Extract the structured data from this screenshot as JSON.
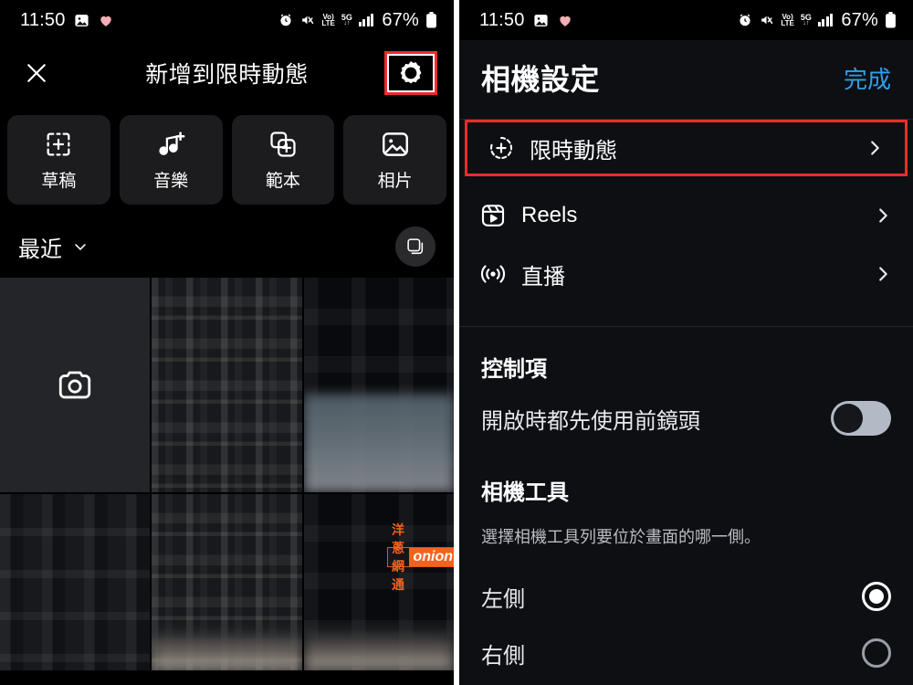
{
  "status_bar": {
    "time": "11:50",
    "battery_percent": "67%",
    "icons": [
      "photo-icon",
      "heart-icon",
      "alarm-icon",
      "mute-icon",
      "volte-icon",
      "5g-icon",
      "signal-icon",
      "battery-icon"
    ],
    "volte_top": "Vo)",
    "volte_bottom": "LTE",
    "net_top": "5G",
    "net_bottom": "↓↑"
  },
  "left_panel": {
    "close_label": "✕",
    "title": "新增到限時動態",
    "settings_icon": "gear-icon",
    "cards": [
      {
        "icon": "draft-plus-icon",
        "label": "草稿"
      },
      {
        "icon": "music-note-plus-icon",
        "label": "音樂"
      },
      {
        "icon": "template-plus-icon",
        "label": "範本"
      },
      {
        "icon": "photo-icon",
        "label": "相片"
      }
    ],
    "gallery": {
      "filter_label": "最近",
      "filter_chevron": "chevron-down-icon",
      "multiselect_icon": "layers-icon",
      "camera_tile_icon": "camera-icon"
    }
  },
  "right_panel": {
    "title": "相機設定",
    "done_label": "完成",
    "done_color": "#2f9fe8",
    "highlight_color": "#ef2b2b",
    "menu": [
      {
        "icon": "story-plus-icon",
        "label": "限時動態",
        "chevron": "chevron-right-icon",
        "highlighted": true
      },
      {
        "icon": "reels-icon",
        "label": "Reels",
        "chevron": "chevron-right-icon",
        "highlighted": false
      },
      {
        "icon": "live-icon",
        "label": "直播",
        "chevron": "chevron-right-icon",
        "highlighted": false
      }
    ],
    "controls": {
      "section_title": "控制項",
      "toggle_label": "開啟時都先使用前鏡頭",
      "toggle_state": "off"
    },
    "camera_tools": {
      "section_title": "相機工具",
      "description": "選擇相機工具列要位於畫面的哪一側。",
      "options": [
        {
          "label": "左側",
          "selected": true
        },
        {
          "label": "右側",
          "selected": false
        }
      ]
    }
  },
  "watermark": {
    "text_cn": "洋蔥網通",
    "text_en": "onion",
    "color": "#f4631c"
  }
}
